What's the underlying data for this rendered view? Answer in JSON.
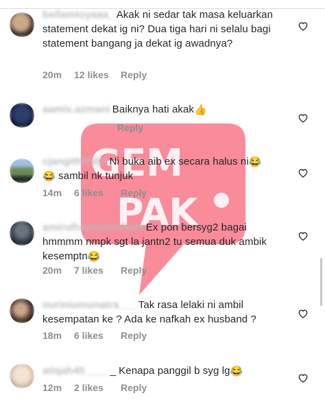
{
  "comments": [
    {
      "username": "bellamtoyaaa_",
      "text": "Akak ni sedar tak masa keluarkan statement dekat ig ni? Dua tiga hari ni selalu bagi statement bangang ja dekat ig awadnya?",
      "time": "20m",
      "likes": "12 likes",
      "reply": "Reply",
      "avatar_colors": [
        "#c9a989",
        "#40302a"
      ]
    },
    {
      "username": "aamis.azmani",
      "text": "Baiknya hati akak",
      "emoji": "👍",
      "time": "",
      "likes": "",
      "reply": "Reply",
      "avatar_colors": [
        "#2c3e6b",
        "#0d1730"
      ]
    },
    {
      "username": "cjangiththt07",
      "text": "Ni buka aib ex secara halus ni",
      "emoji": "😂",
      "emoji2": "😂",
      "text2": " sambil nk tunjuk",
      "time": "14m",
      "likes": "6 likes",
      "reply": "Reply",
      "avatar_colors": [
        "#6d8a57",
        "#21331f"
      ]
    },
    {
      "username": "amirulhanizahiriham",
      "text": "Ex pon bersyg2 bagai hmmmm nmpk sgt la jantn2 tu semua duk ambik kesemptn",
      "emoji": "😂",
      "time": "20m",
      "likes": "7 likes",
      "reply": "Reply",
      "avatar_colors": [
        "#3f4a55",
        "#151a20"
      ]
    },
    {
      "username": "nuriniumunatra___",
      "text": "Tak rasa lelaki ni ambil kesempatan ke ? Ada ke nafkah ex husband ?",
      "time": "18m",
      "likes": "6 likes",
      "reply": "Reply",
      "avatar_colors": [
        "#c7a68e",
        "#2a1d18"
      ]
    },
    {
      "username": "atiqah45____",
      "text": "_ Kenapa panggil b syg lg",
      "emoji": "😂",
      "time": "12m",
      "likes": "2 likes",
      "reply": "Reply",
      "avatar_colors": [
        "#f1e4d5",
        "#c4a689"
      ]
    }
  ],
  "watermark": {
    "line1": "GEM",
    "line2": "PAK",
    "color": "#f6455f"
  }
}
